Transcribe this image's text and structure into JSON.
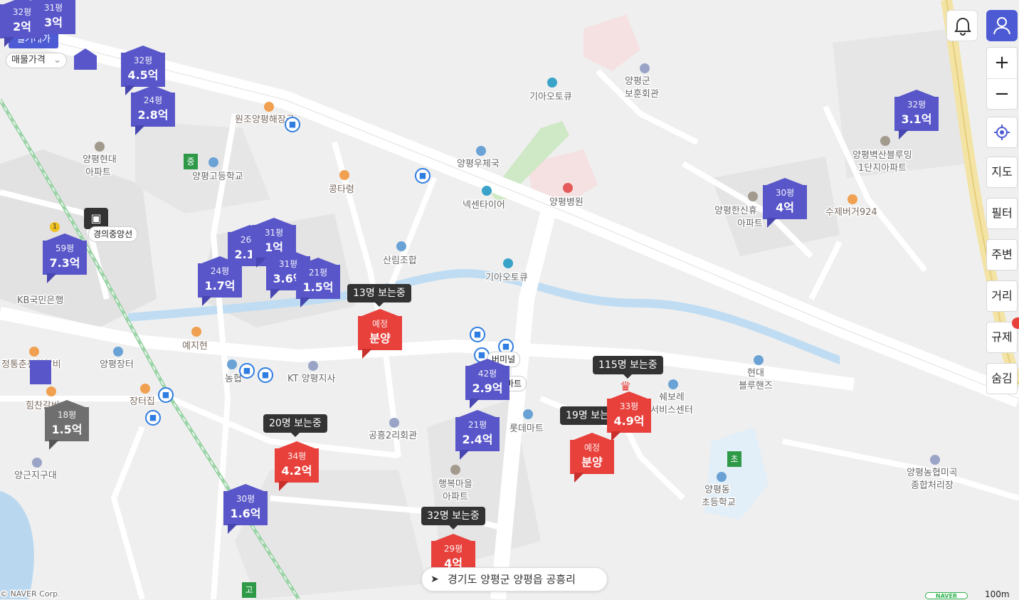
{
  "map": {
    "labels": {
      "gia_otokyu_top": "기아오토큐",
      "yangpyeong_bohun": "양평군\n보훈회관",
      "wonjo": "원조양평해장국",
      "hyundai_apt": "양평현대\n아파트",
      "high_school": "양평고등학교",
      "kongtaryeong": "콩타령",
      "post_office": "양평우체국",
      "hospital": "양평병원",
      "nexen": "넥센타이어",
      "blue_rue": "양평벽산블루밍\n1단지아파트",
      "hansinhyu": "양평한신휴\n아파트",
      "suje_burger": "수제버거924",
      "gyeongui_line": "경의중앙선",
      "kb_bank": "KB국민은행",
      "sanlim": "산림조합",
      "gia_otokyu_mid": "기아오토큐",
      "jangteo": "양평장터",
      "yejihyeon": "예지현",
      "jeongtong": "정통춘천닭갈비",
      "heemchan": "힘찬갈비",
      "nonghyup": "농협",
      "kt": "KT 양평지사",
      "jangteojip": "장터집",
      "gonghung_hall": "공흥2리회관",
      "lotte_mart": "롯데마트",
      "shevrolet": "쉐보레\n서비스센터",
      "hyundai_bluehands": "현대\n블루핸즈",
      "haengbok": "행복마을\n아파트",
      "yangpyeong_dong": "양평동\n초등학교",
      "nonghyup_rice": "양평농협미곡\n종합처리장",
      "yanggeun": "양근지구대",
      "mart_label": "마트",
      "terminal": "버미널",
      "apt_mart": "마트",
      "copyright": "© NAVER Corp.",
      "scale": "100m",
      "naver_logo": "NAVER"
    },
    "schools": {
      "middle": "중",
      "elementary": "초",
      "high": "고"
    },
    "station_number": "1"
  },
  "filters": {
    "pyeong": "평형",
    "real_price": "실거래가",
    "listing_price": "매물가격"
  },
  "markers": [
    {
      "id": "m1",
      "size": "32평",
      "price": "4.5억",
      "color": "blue"
    },
    {
      "id": "m2",
      "size": "24평",
      "price": "2.8억",
      "color": "blue"
    },
    {
      "id": "m3",
      "size": "59평",
      "price": "7.3억",
      "color": "blue"
    },
    {
      "id": "m4",
      "size": "26평",
      "price": "2.1억",
      "color": "blue"
    },
    {
      "id": "m5",
      "size": "31평",
      "price": "1억",
      "color": "blue"
    },
    {
      "id": "m6",
      "size": "24평",
      "price": "1.7억",
      "color": "blue"
    },
    {
      "id": "m7",
      "size": "31평",
      "price": "3.6억",
      "color": "blue"
    },
    {
      "id": "m8",
      "size": "21평",
      "price": "1.5억",
      "color": "blue"
    },
    {
      "id": "m9",
      "size": "예정",
      "price": "분양",
      "color": "red"
    },
    {
      "id": "m10",
      "size": "42평",
      "price": "2.9억",
      "color": "blue"
    },
    {
      "id": "m11",
      "size": "21평",
      "price": "2.4억",
      "color": "blue"
    },
    {
      "id": "m12",
      "size": "34평",
      "price": "4.2억",
      "color": "red"
    },
    {
      "id": "m13",
      "size": "30평",
      "price": "1.6억",
      "color": "blue"
    },
    {
      "id": "m14",
      "size": "18평",
      "price": "1.5억",
      "color": "gray"
    },
    {
      "id": "m15",
      "size": "33평",
      "price": "4.9억",
      "color": "red"
    },
    {
      "id": "m16",
      "size": "예정",
      "price": "분양",
      "color": "red"
    },
    {
      "id": "m17",
      "size": "29평",
      "price": "4억",
      "color": "red"
    },
    {
      "id": "m18",
      "size": "30평",
      "price": "4억",
      "color": "blue"
    },
    {
      "id": "m19",
      "size": "32평",
      "price": "3.1억",
      "color": "blue"
    },
    {
      "id": "m20",
      "size": "32평",
      "price": "2억",
      "color": "blue"
    },
    {
      "id": "m21",
      "size": "31평",
      "price": "3억",
      "color": "blue"
    }
  ],
  "viewing": [
    {
      "id": "v1",
      "text": "13명 보는중"
    },
    {
      "id": "v2",
      "text": "115명 보는중"
    },
    {
      "id": "v3",
      "text": "19명 보는"
    },
    {
      "id": "v4",
      "text": "20명 보는중"
    },
    {
      "id": "v5",
      "text": "32명 보는중"
    }
  ],
  "controls": {
    "zoom_in": "+",
    "zoom_out": "−",
    "map_type": "지도",
    "filter": "필터",
    "nearby": "주변",
    "distance": "거리",
    "regulation": "규제",
    "hide": "숨김"
  },
  "address": "경기도 양평군 양평읍 공흥리",
  "colors": {
    "marker_blue": "#5856c9",
    "marker_red": "#e8413c",
    "marker_gray": "#6f6f6f",
    "user_button": "#4c5bd4",
    "bus_stop": "#2f7de1"
  }
}
